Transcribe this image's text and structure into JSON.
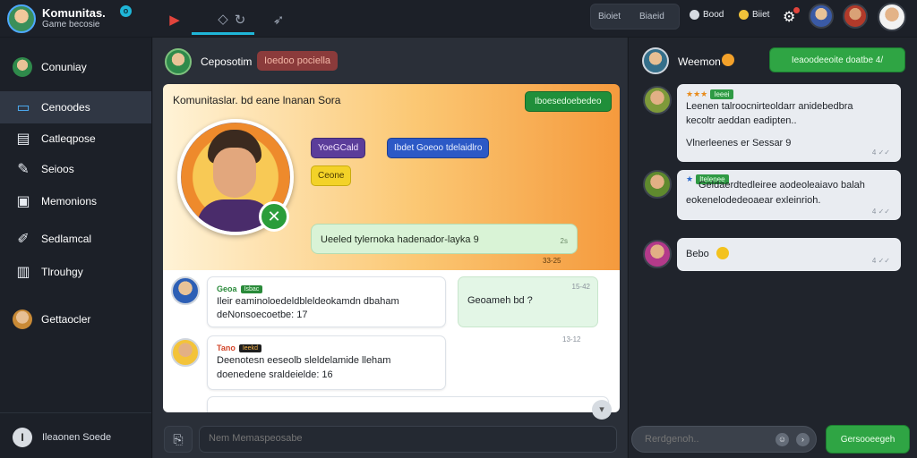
{
  "colors": {
    "accent": "#1fb6d8",
    "brand_green": "#2fa544",
    "card_orange": "#f59a3d",
    "badge_red": "#8b3b3b"
  },
  "header": {
    "app_title": "Komunitas.",
    "app_subtitle": "Game becosie",
    "verified_icon": "info-icon",
    "tabs": [
      {
        "icon": "youtube-icon"
      },
      {
        "icon": "shield-icon"
      },
      {
        "icon": "refresh-icon"
      },
      {
        "icon": "megaphone-icon"
      }
    ],
    "search_labels": [
      "Bioiet",
      "Biaeid"
    ],
    "stats": [
      {
        "label": "Bood",
        "icon": "globe-icon"
      },
      {
        "label": "Biiet",
        "icon": "coin-icon"
      }
    ],
    "settings_icon": "gear-icon"
  },
  "sidebar": {
    "items": [
      {
        "label": "Conuniay",
        "icon": "avatar-icon"
      },
      {
        "label": "Cenoodes",
        "icon": "folder-icon"
      },
      {
        "label": "Catleqpose",
        "icon": "calendar-icon"
      },
      {
        "label": "Seioos",
        "icon": "tools-icon"
      },
      {
        "label": "Memonions",
        "icon": "message-icon"
      },
      {
        "label": "Sedlamcal",
        "icon": "pencil-icon"
      },
      {
        "label": "Tlrouhgy",
        "icon": "bookmark-icon"
      },
      {
        "label": "Gettaocler",
        "icon": "avatar-icon"
      }
    ],
    "footer_label": "Ileaonen Soede",
    "footer_icon": "user-initial-icon"
  },
  "channel": {
    "title": "Ceposotim",
    "badge": "Ioedoo pociella"
  },
  "profile_card": {
    "title": "Komunitaslar. bd eane lnanan Sora",
    "cta": "Iboesedoebedeo",
    "tags": [
      "YoeGCald",
      "Ibdet Goeoo tdelaidlro",
      "Ceone"
    ],
    "bubble_text": "Ueeled tylernoka hadenador-layka 9",
    "bubble_meta": "2s",
    "bubble_time": "33-25"
  },
  "messages": [
    {
      "name": "Geoa",
      "badge": "Isbac",
      "text_lines": [
        "Ileir eaminoloedeldbleldeokamdn dbaham",
        "deNonsoecoetbe: 17"
      ],
      "time": "-"
    },
    {
      "name": "Tano",
      "badge": "Ieekd",
      "text_lines": [
        "Deenotesn eeseolb sleldelamide lleham",
        "doenedene sraldeielde: 16"
      ],
      "time": "-"
    }
  ],
  "reply": {
    "text": "Geoameh bd ?",
    "time": "15-42",
    "time_below": "13-12"
  },
  "composer": {
    "placeholder": "Nem Memaspeosabe",
    "attach_icon": "attachment-icon"
  },
  "right_panel": {
    "title": "Weemon",
    "button": "Ieaoodeeoite doatbe 4/",
    "messages": [
      {
        "rating_badge": "Ieeei",
        "text_lines": [
          "Leenen talroocnirteoldarr anidebedbra",
          "kecoltr aeddan eadipten..",
          "Vlnerleenes er Sessar 9"
        ],
        "meta": "4 ✓✓"
      },
      {
        "rating_badge": "Itelenee",
        "text_lines": [
          "Geldaerdtedleiree aodeoleaiavo balah",
          "eokenelodedeoaear exleinrioh."
        ],
        "meta": "4 ✓✓"
      },
      {
        "text_lines": [
          "Bebo"
        ],
        "meta": "4 ✓✓"
      }
    ],
    "input_placeholder": "Rerdgenoh..",
    "send_button": "Gersooeegeh"
  }
}
